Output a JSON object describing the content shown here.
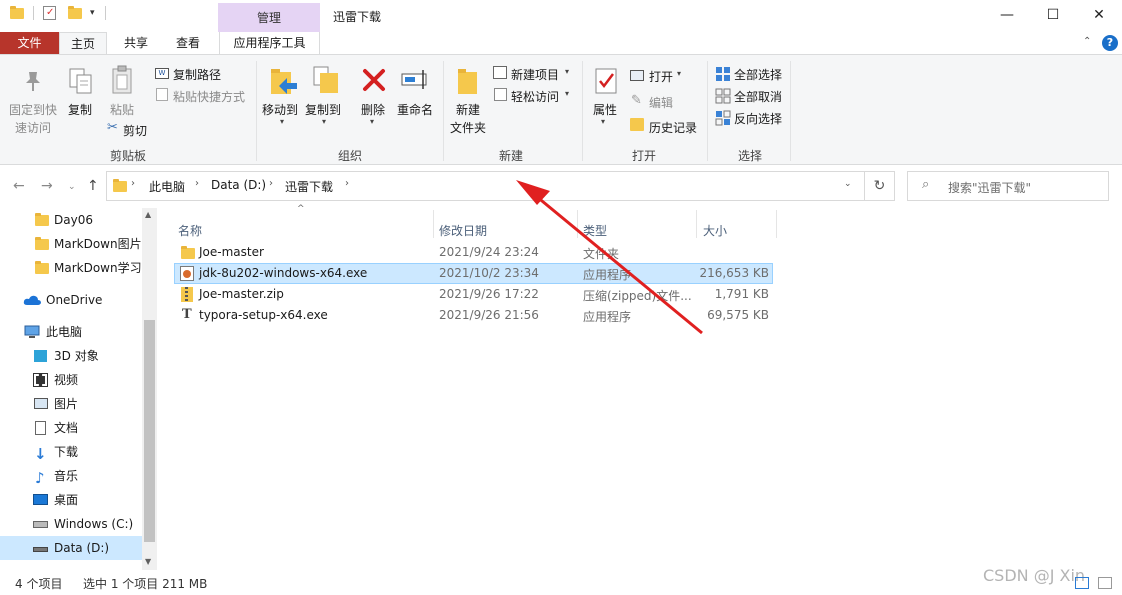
{
  "window": {
    "title": "迅雷下载",
    "context_tab_group": "管理",
    "controls": {
      "minimize": "—",
      "maximize": "☐",
      "close": "✕"
    }
  },
  "ribbon_tabs": [
    "文件",
    "主页",
    "共享",
    "查看",
    "应用程序工具"
  ],
  "ribbon": {
    "clipboard": {
      "label": "剪贴板",
      "pin_line1": "固定到快",
      "pin_line2": "速访问",
      "copy": "复制",
      "paste": "粘贴",
      "copy_path": "复制路径",
      "paste_shortcut": "粘贴快捷方式",
      "cut": "剪切"
    },
    "organize": {
      "label": "组织",
      "move_to": "移动到",
      "copy_to": "复制到",
      "delete": "删除",
      "rename": "重命名"
    },
    "new": {
      "label": "新建",
      "new_folder_line1": "新建",
      "new_folder_line2": "文件夹",
      "new_item": "新建项目",
      "easy_access": "轻松访问"
    },
    "open": {
      "label": "打开",
      "properties": "属性",
      "open": "打开",
      "edit": "编辑",
      "history": "历史记录"
    },
    "select": {
      "label": "选择",
      "select_all": "全部选择",
      "select_none": "全部取消",
      "invert": "反向选择"
    }
  },
  "address": {
    "breadcrumb": [
      "此电脑",
      "Data (D:)",
      "迅雷下载"
    ],
    "search_placeholder": "搜索\"迅雷下载\""
  },
  "nav_pane": [
    {
      "label": "Day06",
      "icon": "folder-icon"
    },
    {
      "label": "MarkDown图片",
      "icon": "folder-icon"
    },
    {
      "label": "MarkDown学习",
      "icon": "folder-icon"
    },
    {
      "label": "OneDrive",
      "icon": "onedrive-icon"
    },
    {
      "label": "此电脑",
      "icon": "this-pc-icon"
    },
    {
      "label": "3D 对象",
      "icon": "3d-objects-icon"
    },
    {
      "label": "视频",
      "icon": "video-icon"
    },
    {
      "label": "图片",
      "icon": "pictures-icon"
    },
    {
      "label": "文档",
      "icon": "documents-icon"
    },
    {
      "label": "下载",
      "icon": "downloads-icon"
    },
    {
      "label": "音乐",
      "icon": "music-icon"
    },
    {
      "label": "桌面",
      "icon": "desktop-icon"
    },
    {
      "label": "Windows (C:)",
      "icon": "drive-c-icon"
    },
    {
      "label": "Data (D:)",
      "icon": "drive-d-icon",
      "selected": true
    }
  ],
  "columns": [
    "名称",
    "修改日期",
    "类型",
    "大小"
  ],
  "files": [
    {
      "name": "Joe-master",
      "date": "2021/9/24 23:24",
      "type": "文件夹",
      "size": "",
      "icon": "folder-icon"
    },
    {
      "name": "jdk-8u202-windows-x64.exe",
      "date": "2021/10/2 23:34",
      "type": "应用程序",
      "size": "216,653 KB",
      "icon": "installer-icon",
      "selected": true
    },
    {
      "name": "Joe-master.zip",
      "date": "2021/9/26 17:22",
      "type": "压缩(zipped)文件...",
      "size": "1,791 KB",
      "icon": "zip-folder-icon"
    },
    {
      "name": "typora-setup-x64.exe",
      "date": "2021/9/26 21:56",
      "type": "应用程序",
      "size": "69,575 KB",
      "icon": "exe-icon"
    }
  ],
  "status": {
    "count": "4 个项目",
    "selection": "选中 1 个项目  211 MB"
  },
  "watermark": "CSDN @J  Xin",
  "colors": {
    "file_tab": "#b7352b",
    "manage_tab": "#e5d4f4",
    "selection": "#cce8ff",
    "arrow": "#e02020"
  }
}
